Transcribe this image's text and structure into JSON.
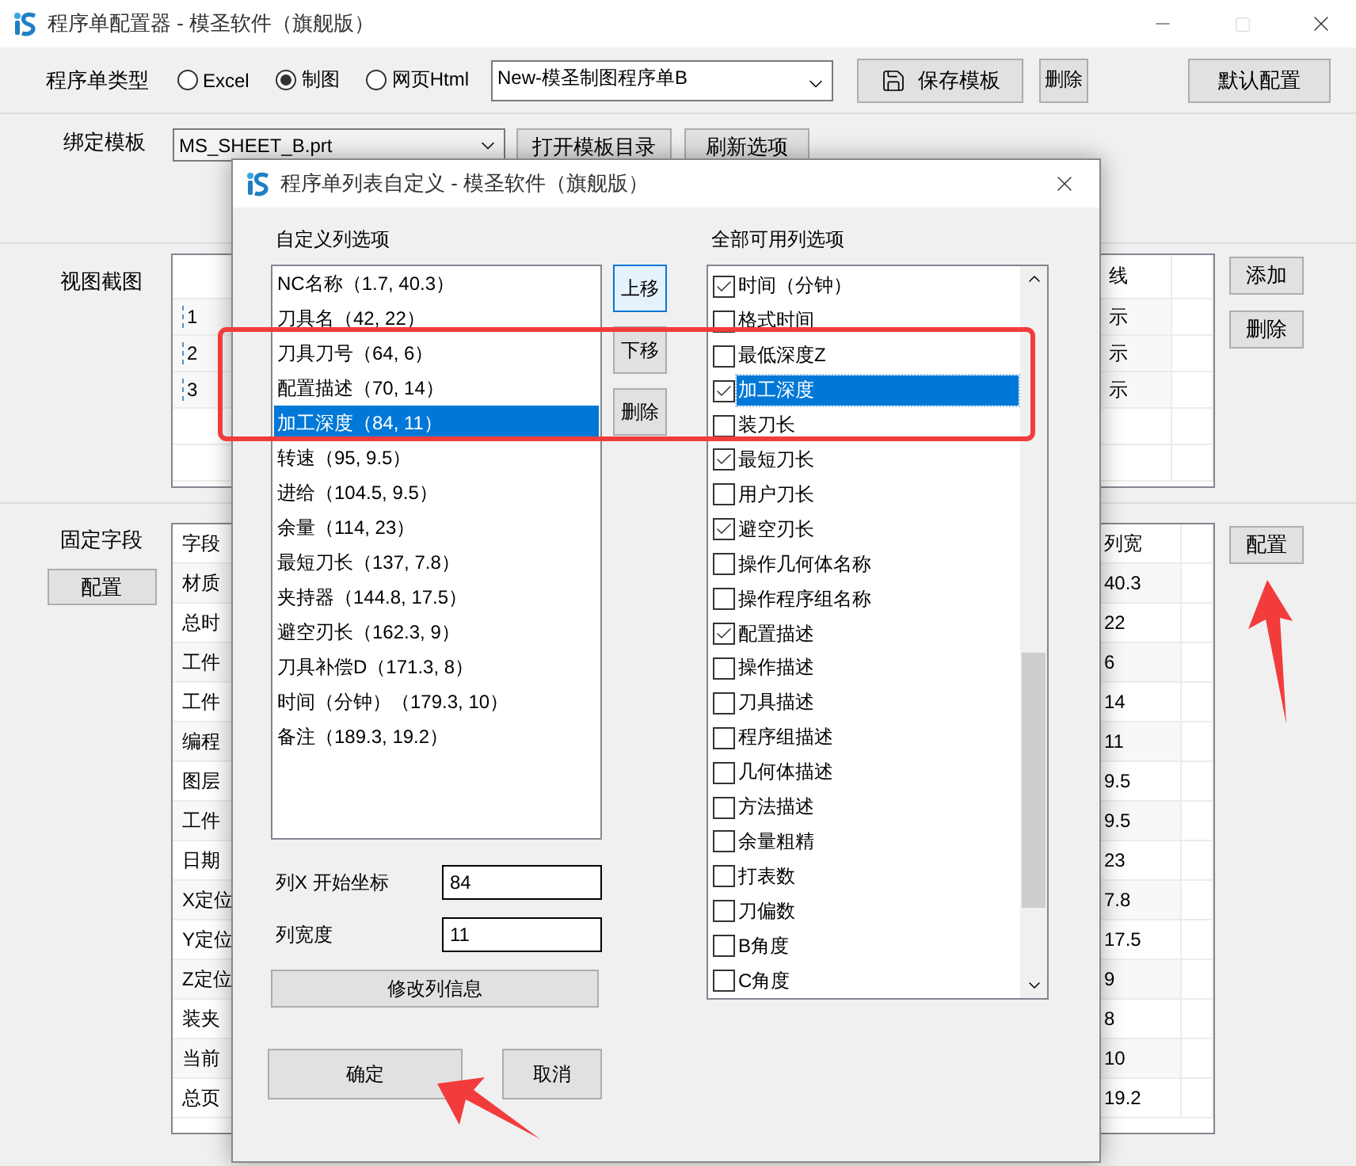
{
  "window": {
    "title": "程序单配置器 - 模圣软件（旗舰版）"
  },
  "type_row": {
    "label": "程序单类型",
    "options": [
      {
        "label": "Excel",
        "selected": false
      },
      {
        "label": "制图",
        "selected": true
      },
      {
        "label": "网页Html",
        "selected": false
      }
    ],
    "template_combo": "New-模圣制图程序单B",
    "buttons": [
      "保存模板",
      "删除",
      "默认配置"
    ]
  },
  "bind_row": {
    "label": "绑定模板",
    "combo": "MS_SHEET_B.prt",
    "buttons": [
      "打开模板目录",
      "刷新选项"
    ]
  },
  "view_section": {
    "label": "视图截图",
    "header": "线",
    "rows": [
      {
        "number": "1",
        "value": "示"
      },
      {
        "number": "2",
        "value": "示"
      },
      {
        "number": "3",
        "value": "示"
      }
    ],
    "buttons": [
      "添加",
      "删除"
    ]
  },
  "fixed_section": {
    "label": "固定字段",
    "button": "配置",
    "header": [
      "字段",
      "列宽"
    ],
    "rows": [
      [
        "材质",
        "40.3"
      ],
      [
        "总时",
        "22"
      ],
      [
        "工件",
        "6"
      ],
      [
        "工件",
        "14"
      ],
      [
        "编程",
        "11"
      ],
      [
        "图层",
        "9.5"
      ],
      [
        "工件",
        "9.5"
      ],
      [
        "日期",
        "23"
      ],
      [
        "X定位",
        "7.8"
      ],
      [
        "Y定位",
        "17.5"
      ],
      [
        "Z定位",
        "9"
      ],
      [
        "装夹",
        "8"
      ],
      [
        "当前",
        "10"
      ],
      [
        "总页",
        "19.2"
      ]
    ],
    "side_button": "配置"
  },
  "dialog": {
    "title": "程序单列表自定义 - 模圣软件（旗舰版）",
    "left_label": "自定义列选项",
    "columns": [
      {
        "text": "NC名称（1.7, 40.3）",
        "selected": false
      },
      {
        "text": "刀具名（42, 22）",
        "selected": false
      },
      {
        "text": "刀具刀号（64, 6）",
        "selected": false
      },
      {
        "text": "配置描述（70, 14）",
        "selected": false
      },
      {
        "text": "加工深度（84, 11）",
        "selected": true
      },
      {
        "text": "转速（95, 9.5）",
        "selected": false
      },
      {
        "text": "进给（104.5, 9.5）",
        "selected": false
      },
      {
        "text": "余量（114, 23）",
        "selected": false
      },
      {
        "text": "最短刀长（137, 7.8）",
        "selected": false
      },
      {
        "text": "夹持器（144.8, 17.5）",
        "selected": false
      },
      {
        "text": "避空刃长（162.3, 9）",
        "selected": false
      },
      {
        "text": "刀具补偿D（171.3, 8）",
        "selected": false
      },
      {
        "text": "时间（分钟）（179.3, 10）",
        "selected": false
      },
      {
        "text": "备注（189.3, 19.2）",
        "selected": false
      }
    ],
    "move_buttons": [
      {
        "label": "上移",
        "focused": true
      },
      {
        "label": "下移",
        "focused": false
      },
      {
        "label": "删除",
        "focused": false
      }
    ],
    "right_label": "全部可用列选项",
    "available": [
      {
        "text": "时间（分钟）",
        "checked": true,
        "selected": false
      },
      {
        "text": "格式时间",
        "checked": false,
        "selected": false
      },
      {
        "text": "最低深度Z",
        "checked": false,
        "selected": false
      },
      {
        "text": "加工深度",
        "checked": true,
        "selected": true
      },
      {
        "text": "装刀长",
        "checked": false,
        "selected": false
      },
      {
        "text": "最短刀长",
        "checked": true,
        "selected": false
      },
      {
        "text": "用户刀长",
        "checked": false,
        "selected": false
      },
      {
        "text": "避空刃长",
        "checked": true,
        "selected": false
      },
      {
        "text": "操作几何体名称",
        "checked": false,
        "selected": false
      },
      {
        "text": "操作程序组名称",
        "checked": false,
        "selected": false
      },
      {
        "text": "配置描述",
        "checked": true,
        "selected": false
      },
      {
        "text": "操作描述",
        "checked": false,
        "selected": false
      },
      {
        "text": "刀具描述",
        "checked": false,
        "selected": false
      },
      {
        "text": "程序组描述",
        "checked": false,
        "selected": false
      },
      {
        "text": "几何体描述",
        "checked": false,
        "selected": false
      },
      {
        "text": "方法描述",
        "checked": false,
        "selected": false
      },
      {
        "text": "余量粗精",
        "checked": false,
        "selected": false
      },
      {
        "text": "打表数",
        "checked": false,
        "selected": false
      },
      {
        "text": "刀偏数",
        "checked": false,
        "selected": false
      },
      {
        "text": "B角度",
        "checked": false,
        "selected": false
      },
      {
        "text": "C角度",
        "checked": false,
        "selected": false
      }
    ],
    "fields": [
      {
        "label": "列X 开始坐标",
        "value": "84"
      },
      {
        "label": "列宽度",
        "value": "11"
      }
    ],
    "modify_button": "修改列信息",
    "ok_button": "确定",
    "cancel_button": "取消"
  }
}
